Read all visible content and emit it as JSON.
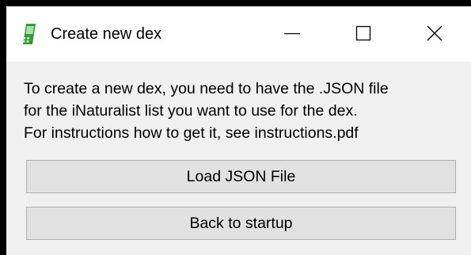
{
  "window": {
    "title": "Create new dex",
    "icon": "green-device-icon",
    "controls": {
      "minimize": "minimize-icon",
      "maximize": "maximize-icon",
      "close": "close-icon"
    }
  },
  "main": {
    "description_lines": [
      "To create a new dex, you need to have the .JSON file",
      "for the iNaturalist list you want to use for the dex.",
      "For instructions how to get it, see instructions.pdf"
    ],
    "load_button_label": "Load JSON File",
    "back_button_label": "Back to startup"
  },
  "colors": {
    "accent": "#2e8b2e",
    "button_bg": "#e1e1e1",
    "button_border": "#adadad",
    "window_bg": "#f0f0f0"
  }
}
